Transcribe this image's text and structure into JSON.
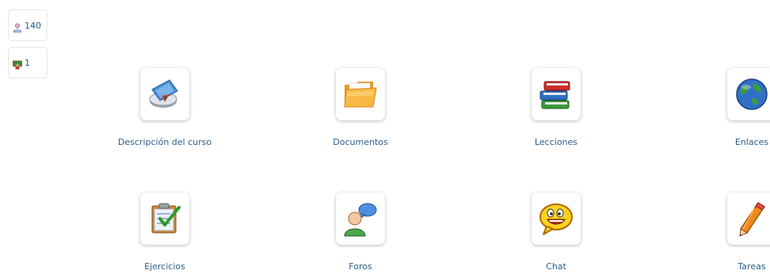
{
  "stats": {
    "users_count": "140",
    "teachers_count": "1"
  },
  "tools": [
    {
      "label": "Descripción del curso",
      "icon": "course-description-icon"
    },
    {
      "label": "Documentos",
      "icon": "folder-icon"
    },
    {
      "label": "Lecciones",
      "icon": "books-icon"
    },
    {
      "label": "Enlaces",
      "icon": "globe-icon"
    },
    {
      "label": "Ejercicios",
      "icon": "checklist-icon"
    },
    {
      "label": "Foros",
      "icon": "forum-user-icon"
    },
    {
      "label": "Chat",
      "icon": "smiley-chat-icon"
    },
    {
      "label": "Tareas",
      "icon": "pencil-icon"
    }
  ],
  "colors": {
    "link": "#2a5e8a",
    "card_border": "#e6e6e6"
  }
}
